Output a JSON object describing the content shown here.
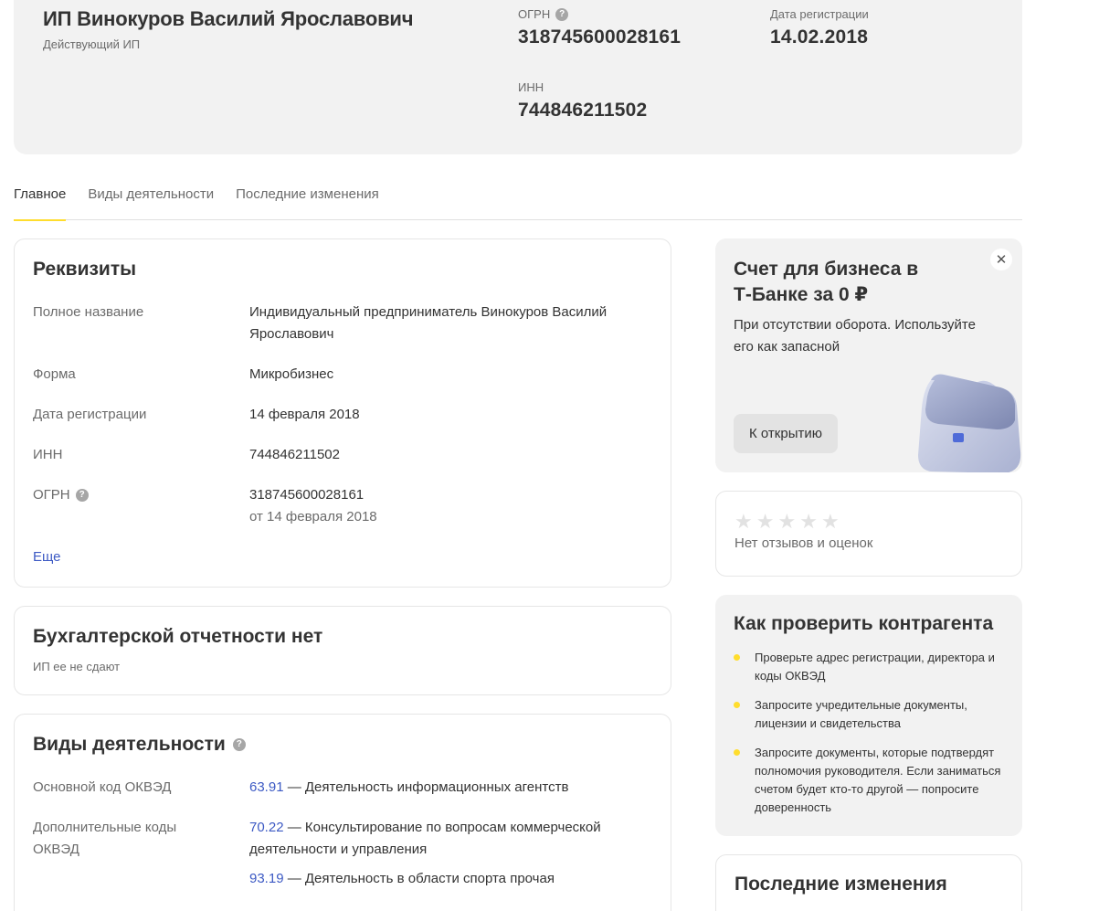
{
  "header": {
    "name": "ИП Винокуров Василий Ярославович",
    "status": "Действующий ИП",
    "ogrn_label": "ОГРН",
    "ogrn_value": "318745600028161",
    "reg_label": "Дата регистрации",
    "reg_value": "14.02.2018",
    "inn_label": "ИНН",
    "inn_value": "744846211502"
  },
  "tabs": [
    {
      "label": "Главное",
      "active": true
    },
    {
      "label": "Виды деятельности",
      "active": false
    },
    {
      "label": "Последние изменения",
      "active": false
    }
  ],
  "requisites": {
    "title": "Реквизиты",
    "rows": [
      {
        "label": "Полное название",
        "value": "Индивидуальный предприниматель Винокуров Василий Ярославович"
      },
      {
        "label": "Форма",
        "value": "Микробизнес"
      },
      {
        "label": "Дата регистрации",
        "value": "14 февраля 2018"
      },
      {
        "label": "ИНН",
        "value": "744846211502"
      },
      {
        "label": "ОГРН",
        "value": "318745600028161",
        "sub": "от 14 февраля 2018"
      }
    ],
    "more_link": "Еще"
  },
  "accounting": {
    "title": "Бухгалтерской отчетности нет",
    "subtitle": "ИП ее не сдают"
  },
  "activities": {
    "title": "Виды деятельности",
    "main_label": "Основной код ОКВЭД",
    "main": {
      "code": "63.91",
      "text": " — Деятельность информационных агентств"
    },
    "extra_label": "Дополнительные коды ОКВЭД",
    "extra": [
      {
        "code": "70.22",
        "text": " — Консультирование по вопросам коммерческой деятельности и управления"
      },
      {
        "code": "93.19",
        "text": " — Деятельность в области спорта прочая"
      }
    ]
  },
  "promo": {
    "title": "Счет для бизнеса в Т‑Банке за 0 ₽",
    "text": "При отсутствии оборота. Используйте его как запасной",
    "button": "К открытию",
    "close": "✕"
  },
  "reviews": {
    "stars": 5,
    "filled": 0,
    "text": "Нет отзывов и оценок"
  },
  "check": {
    "title": "Как проверить контрагента",
    "tips": [
      "Проверьте адрес регистрации, директора и коды ОКВЭД",
      "Запросите учредительные документы, лицензии и свидетельства",
      "Запросите документы, которые подтвердят полномочия руководителя. Если заниматься счетом будет кто‑то другой — попросите доверенность"
    ]
  },
  "changes": {
    "title": "Последние изменения"
  },
  "colors": {
    "accent": "#ffdd2d",
    "link": "#3d5ac4",
    "panel": "#f2f2f2"
  },
  "icons": {
    "help": "question-circle-icon",
    "close": "close-icon",
    "star": "star-icon",
    "bullet": "bullet-dot-icon",
    "briefcase": "briefcase-illustration"
  }
}
